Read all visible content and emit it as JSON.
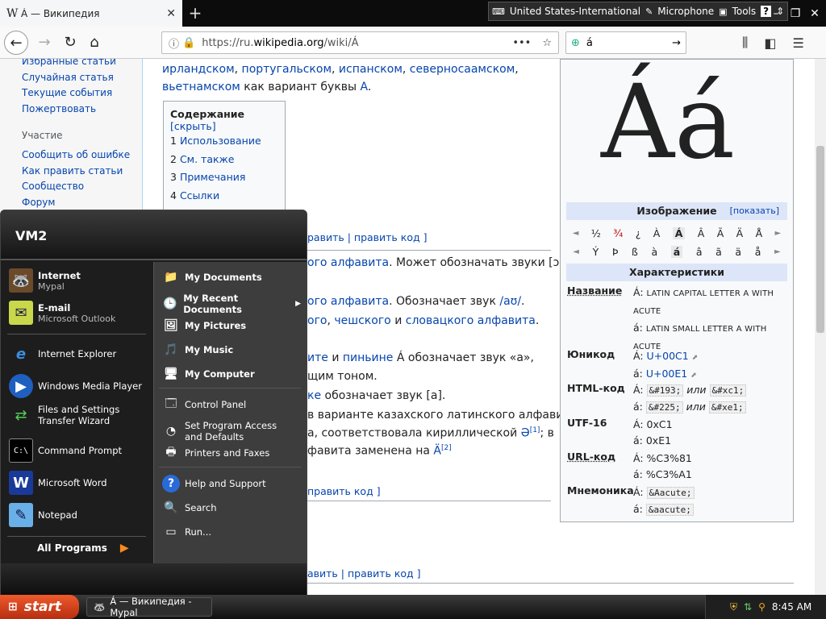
{
  "browser": {
    "tab_title": "Á — Википедия",
    "tab_favicon": "W",
    "url_prefix": "https://ru.",
    "url_host": "wikipedia.org",
    "url_path": "/wiki/Á",
    "search_value": "á"
  },
  "langbar": {
    "keyboard": "United States-International",
    "microphone": "Microphone",
    "tools": "Tools"
  },
  "sidebar": {
    "items_top": [
      "Избранные статьи",
      "Случайная статья",
      "Текущие события",
      "Пожертвовать"
    ],
    "heading": "Участие",
    "items_participation": [
      "Сообщить об ошибке",
      "Как править статьи",
      "Сообщество",
      "Форум"
    ]
  },
  "article": {
    "intro_line1_links": [
      "ирландском",
      "португальском",
      "испанском",
      "северносаамском"
    ],
    "intro_line2_link": "вьетнамском",
    "intro_line2_text": " как вариант буквы ",
    "intro_line2_link2": "A",
    "toc": {
      "title": "Содержание",
      "toggle": "[скрыть]",
      "items": [
        {
          "num": "1",
          "label": "Использование"
        },
        {
          "num": "2",
          "label": "См. также"
        },
        {
          "num": "3",
          "label": "Примечания"
        },
        {
          "num": "4",
          "label": "Ссылки"
        }
      ]
    },
    "edit_row1": "равить | править код ]",
    "line_a_link": "ого алфавита",
    "line_a_text": ". Может обозначать звуки [ɔ]",
    "line_b_link": "ого алфавита",
    "line_b_text": ". Обозначает звук ",
    "line_b_link2": "/aʊ/",
    "line_c_link1": "ого",
    "line_c_link2": "чешского",
    "line_c_and": " и ",
    "line_c_link3": "словацкого алфавита",
    "line_d_link1": "ите",
    "line_d_link2": "пиньине",
    "line_d_text": " Á обозначает звук «а»,",
    "line_e_text": "щим тоном.",
    "line_f_link": "ке",
    "line_f_text": " обозначает звук [a].",
    "line_g_text": "в варианте казахского латинского алфавита",
    "line_h_text": "а, соответствовала кириллической ",
    "line_h_link": "Ә",
    "line_h_ref": "[1]",
    "line_h_end": "; в",
    "line_i_text": "фавита заменена на ",
    "line_i_link": "Ä",
    "line_i_ref": "[2]",
    "edit_row2": "править код ]",
    "edit_row3": "авить | править код ]"
  },
  "infobox": {
    "glyph": "Áá",
    "image_header": "Изображение",
    "image_toggle": "[показать]",
    "row1": [
      "◄",
      "½",
      "¾",
      "¿",
      "À",
      "Á",
      "Â",
      "Ã",
      "Ä",
      "Å",
      "►"
    ],
    "row2": [
      "◄",
      "Ý",
      "Þ",
      "ß",
      "à",
      "á",
      "â",
      "ã",
      "ä",
      "å",
      "►"
    ],
    "char_header": "Характеристики",
    "name_key": "Название",
    "name_upper_char": "Á:",
    "name_upper": "LATIN CAPITAL LETTER A WITH ACUTE",
    "name_lower_char": "á:",
    "name_lower": "LATIN SMALL LETTER A WITH ACUTE",
    "unicode_key": "Юникод",
    "unicode_upper_char": "Á:",
    "unicode_upper": "U+00C1",
    "unicode_lower_char": "á:",
    "unicode_lower": "U+00E1",
    "html_key": "HTML-код",
    "html_upper_char": "Á:",
    "html_upper_dec": "&#193;",
    "html_or": "или",
    "html_upper_hex": "&#xc1;",
    "html_lower_char": "á:",
    "html_lower_dec": "&#225;",
    "html_lower_hex": "&#xe1;",
    "utf16_key": "UTF-16",
    "utf16_upper": "Á: 0xC1",
    "utf16_lower": "á: 0xE1",
    "url_key": "URL-код",
    "url_upper": "Á: %C3%81",
    "url_lower": "á: %C3%A1",
    "mnem_key": "Мнемоника",
    "mnem_upper_char": "Á:",
    "mnem_upper": "&Aacute;",
    "mnem_lower_char": "á:",
    "mnem_lower": "&aacute;"
  },
  "startmenu": {
    "user": "VM2",
    "pinned": [
      {
        "label": "Internet",
        "sub": "Mypal",
        "icon": "mypal-raccoon-icon"
      },
      {
        "label": "E-mail",
        "sub": "Microsoft Outlook",
        "icon": "outlook-icon"
      }
    ],
    "recent": [
      {
        "label": "Internet Explorer",
        "icon": "internet-explorer-icon"
      },
      {
        "label": "Windows Media Player",
        "icon": "media-player-icon"
      },
      {
        "label": "Files and Settings Transfer Wizard",
        "icon": "transfer-wizard-icon"
      },
      {
        "label": "Command Prompt",
        "icon": "command-prompt-icon"
      },
      {
        "label": "Microsoft Word",
        "icon": "word-icon"
      },
      {
        "label": "Notepad",
        "icon": "notepad-icon"
      }
    ],
    "all_programs": "All Programs",
    "right_top": [
      {
        "label": "My Documents",
        "icon": "folder-icon"
      },
      {
        "label": "My Recent Documents",
        "icon": "recent-docs-icon"
      },
      {
        "label": "My Pictures",
        "icon": "pictures-folder-icon"
      },
      {
        "label": "My Music",
        "icon": "music-folder-icon"
      },
      {
        "label": "My Computer",
        "icon": "computer-icon"
      }
    ],
    "right_mid": [
      {
        "label": "Control Panel",
        "icon": "control-panel-icon"
      },
      {
        "label": "Set Program Access and Defaults",
        "icon": "program-defaults-icon"
      },
      {
        "label": "Printers and Faxes",
        "icon": "printer-icon"
      }
    ],
    "right_bottom": [
      {
        "label": "Help and Support",
        "icon": "help-icon"
      },
      {
        "label": "Search",
        "icon": "search-icon"
      },
      {
        "label": "Run...",
        "icon": "run-icon"
      }
    ]
  },
  "taskbar": {
    "start_label": "start",
    "task_label": "Á — Википедия - Mypal",
    "clock": "8:45 AM"
  }
}
